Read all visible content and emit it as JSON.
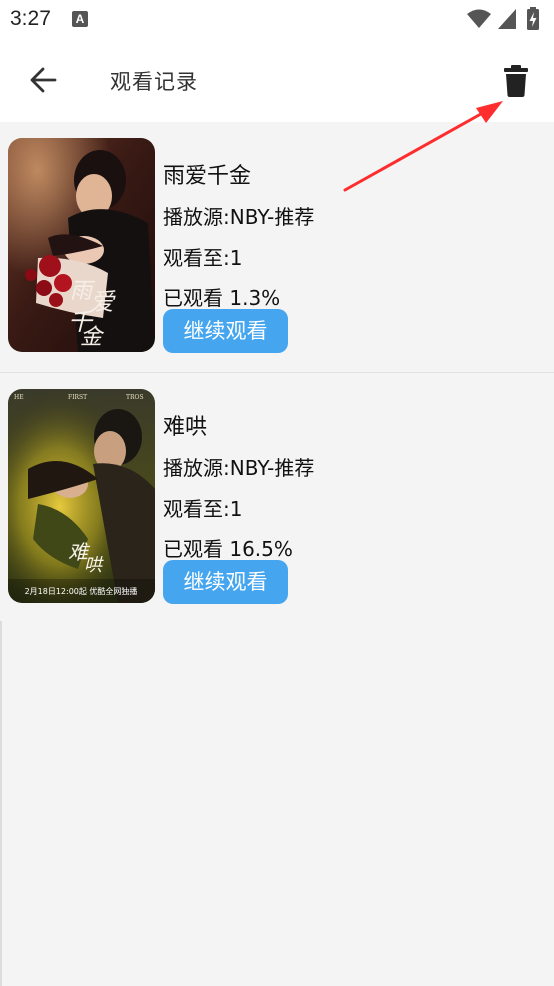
{
  "status_bar": {
    "time": "3:27",
    "notification_icon": "a-notification-icon",
    "icons": [
      "wifi-icon",
      "signal-icon",
      "battery-charging-icon"
    ]
  },
  "app_bar": {
    "back_icon": "arrow-left-icon",
    "title": "观看记录",
    "delete_icon": "trash-icon"
  },
  "history": [
    {
      "title": "雨爱千金",
      "source": "播放源:NBY-推荐",
      "watched_to": "观看至:1",
      "progress": "已观看 1.3%",
      "button": "继续观看",
      "poster_text": "雨爱千金"
    },
    {
      "title": "难哄",
      "source": "播放源:NBY-推荐",
      "watched_to": "观看至:1",
      "progress": "已观看 16.5%",
      "button": "继续观看",
      "poster_text": "2月18日12:00起 优酷全网独播",
      "poster_header": [
        "FIRST",
        "TROS"
      ]
    }
  ],
  "colors": {
    "accent": "#45a5ef",
    "annotation": "#ff2d2d",
    "background": "#f4f4f4"
  }
}
